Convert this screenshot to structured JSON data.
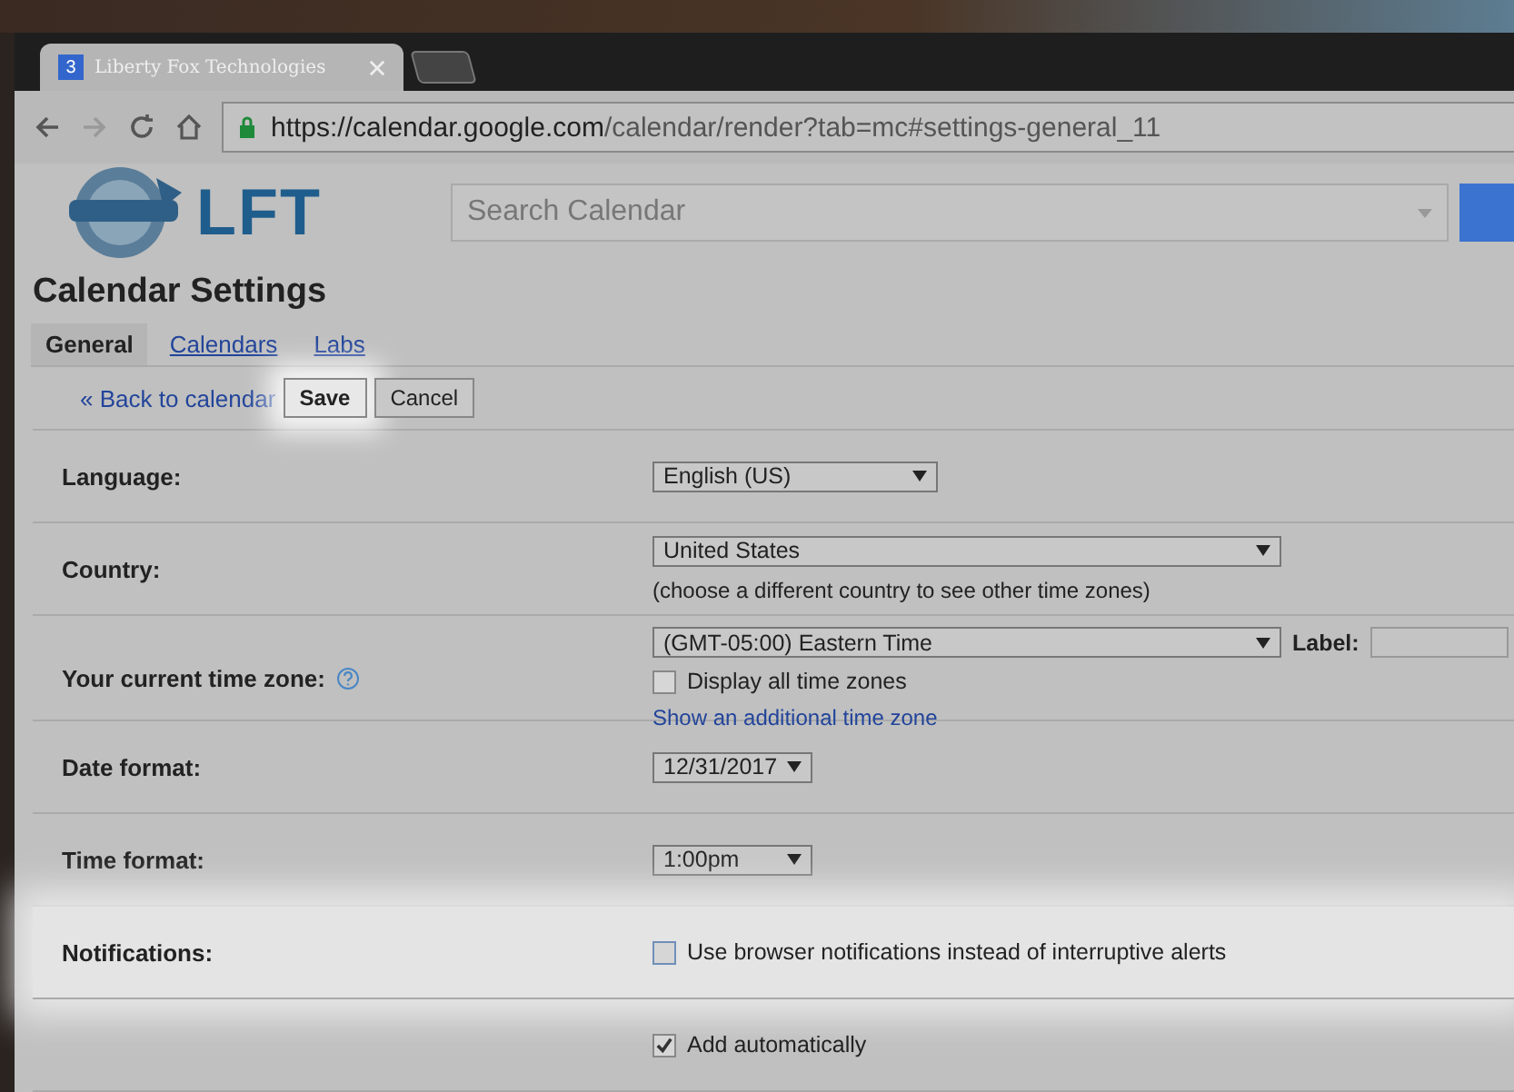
{
  "browser": {
    "tab": {
      "badge": "3",
      "title": "Liberty Fox Technologies"
    },
    "url": {
      "host": "https://calendar.google.com",
      "path": "/calendar/render?tab=mc#settings-general_11"
    }
  },
  "header": {
    "logo_text": "LFT",
    "search": {
      "placeholder": "Search Calendar"
    }
  },
  "title": "Calendar Settings",
  "tabs": [
    {
      "label": "General",
      "selected": true
    },
    {
      "label": "Calendars",
      "selected": false
    },
    {
      "label": "Labs",
      "selected": false
    }
  ],
  "actions": {
    "back_link": "« Back to calendar",
    "buttons": [
      {
        "label": "Save",
        "highlighted": true
      },
      {
        "label": "Cancel",
        "highlighted": false
      }
    ]
  },
  "rows": [
    {
      "kind": "select",
      "label": "Language:",
      "value": "English (US)",
      "highlighted": false
    },
    {
      "kind": "select",
      "label": "Country:",
      "value": "United States",
      "note": "(choose a different country to see other time zones)",
      "highlighted": false
    },
    {
      "kind": "timezone",
      "label": "Your current time zone:",
      "value": "(GMT-05:00) Eastern Time",
      "field_label": "Label:",
      "checkbox": {
        "label": "Display all time zones",
        "checked": false
      },
      "link": "Show an additional time zone",
      "highlighted": false
    },
    {
      "kind": "select",
      "label": "Date format:",
      "value": "12/31/2017",
      "highlighted": false
    },
    {
      "kind": "select",
      "label": "Time format:",
      "value": "1:00pm",
      "highlighted": false
    },
    {
      "kind": "checkbox",
      "label": "Notifications:",
      "checkbox": {
        "label": "Use browser notifications instead of interruptive alerts",
        "checked": false
      },
      "highlighted": true
    },
    {
      "kind": "checkbox",
      "checkbox": {
        "label": "Add automatically",
        "checked": true
      },
      "highlighted": false
    }
  ]
}
